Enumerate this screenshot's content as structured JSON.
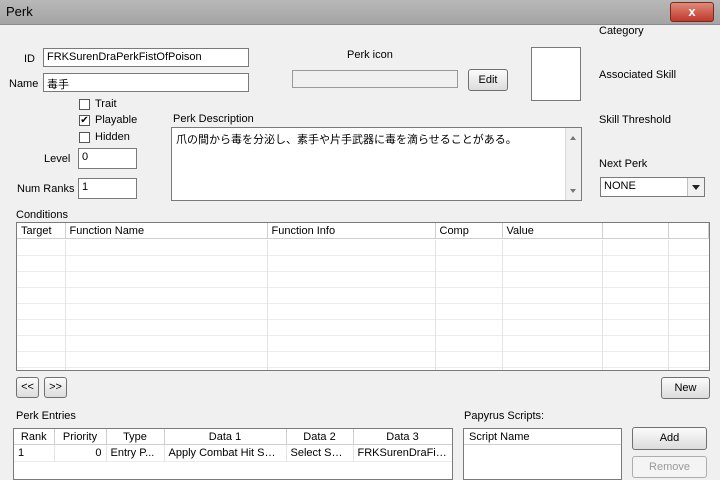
{
  "window": {
    "title": "Perk",
    "close": "x"
  },
  "fields": {
    "id_label": "ID",
    "id_value": "FRKSurenDraPerkFistOfPoison",
    "name_label": "Name",
    "name_value": "毒手",
    "perk_icon_label": "Perk icon",
    "edit_label": "Edit",
    "trait_label": "Trait",
    "playable_label": "Playable",
    "hidden_label": "Hidden",
    "level_label": "Level",
    "level_value": "0",
    "num_ranks_label": "Num Ranks",
    "num_ranks_value": "1",
    "desc_label": "Perk Description",
    "desc_value": "爪の間から毒を分泌し、素手や片手武器に毒を滴らせることがある。",
    "checks": {
      "trait": false,
      "playable": true,
      "hidden": false
    }
  },
  "side": {
    "category": "Category",
    "associated_skill": "Associated Skill",
    "skill_threshold": "Skill Threshold",
    "next_perk": "Next Perk",
    "next_perk_value": "NONE"
  },
  "conditions": {
    "label": "Conditions",
    "columns": [
      "Target",
      "Function Name",
      "Function Info",
      "Comp",
      "Value",
      ""
    ],
    "prev": "<<",
    "next": ">>",
    "new": "New"
  },
  "entries": {
    "label": "Perk Entries",
    "columns": [
      "Rank",
      "Priority",
      "Type",
      "Data 1",
      "Data 2",
      "Data 3"
    ],
    "rows": [
      [
        "1",
        "0",
        "Entry P...",
        "Apply Combat Hit Spell",
        "Select Spell",
        "FRKSurenDraFist..."
      ]
    ]
  },
  "scripts": {
    "label": "Papyrus Scripts:",
    "column": "Script Name",
    "add": "Add",
    "remove": "Remove"
  }
}
